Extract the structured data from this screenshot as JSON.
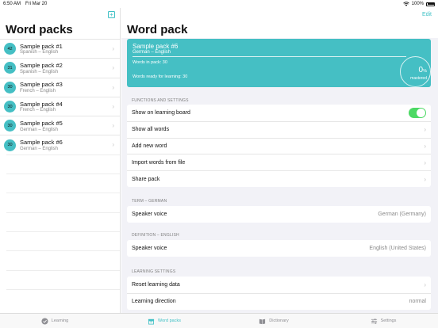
{
  "status": {
    "time": "6:50 AM",
    "date": "Fri Mar 20",
    "battery": "100%"
  },
  "sidebar": {
    "title": "Word packs",
    "packs": [
      {
        "count": "42",
        "title": "Sample pack #1",
        "langs": "Spanish – English"
      },
      {
        "count": "31",
        "title": "Sample pack #2",
        "langs": "Spanish – English"
      },
      {
        "count": "30",
        "title": "Sample pack #3",
        "langs": "French – English"
      },
      {
        "count": "30",
        "title": "Sample pack #4",
        "langs": "French – English"
      },
      {
        "count": "30",
        "title": "Sample pack #5",
        "langs": "German – English"
      },
      {
        "count": "30",
        "title": "Sample pack #6",
        "langs": "German – English"
      }
    ]
  },
  "detail": {
    "title": "Word pack",
    "edit_label": "Edit",
    "card": {
      "title": "Sample pack #6",
      "langs": "German – English",
      "words_in_pack": "Words in pack: 30",
      "words_ready": "Words ready for learning: 30",
      "percent": "0",
      "percent_sign": "%",
      "mastered_label": "mastered"
    },
    "functions": {
      "label": "FUNCTIONS AND SETTINGS",
      "show_on_board": "Show on learning board",
      "show_all": "Show all words",
      "add_new": "Add new word",
      "import": "Import words from file",
      "share": "Share pack"
    },
    "term": {
      "label": "TERM – GERMAN",
      "speaker_label": "Speaker voice",
      "speaker_value": "German (Germany)"
    },
    "definition": {
      "label": "DEFINITION – ENGLISH",
      "speaker_label": "Speaker voice",
      "speaker_value": "English (United States)"
    },
    "learning": {
      "label": "LEARNING SETTINGS",
      "reset": "Reset learning data",
      "direction_label": "Learning direction",
      "direction_value": "normal"
    }
  },
  "tabs": {
    "learning": "Learning",
    "word_packs": "Word packs",
    "dictionary": "Dictionary",
    "settings": "Settings"
  },
  "colors": {
    "accent": "#3ec0c5",
    "toggle_on": "#4cd964"
  }
}
